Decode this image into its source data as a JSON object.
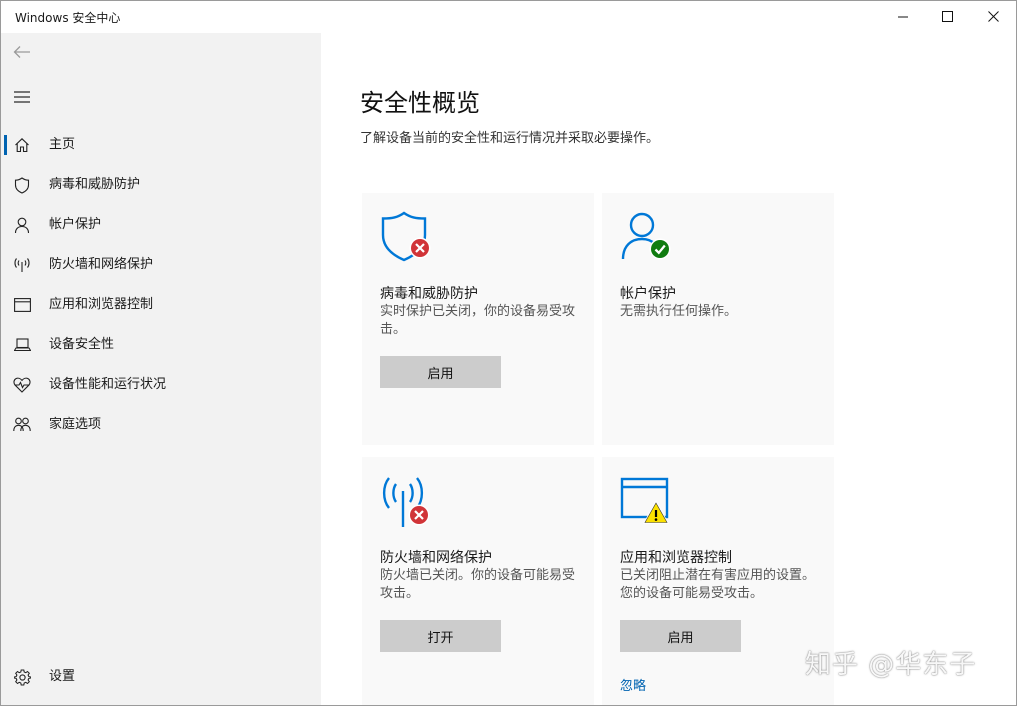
{
  "window": {
    "title": "Windows 安全中心",
    "minimize_icon": "minimize-icon",
    "maximize_icon": "maximize-icon",
    "close_icon": "close-icon"
  },
  "sidebar": {
    "back_icon": "back-arrow-icon",
    "menu_icon": "hamburger-menu-icon",
    "items": [
      {
        "label": "主页",
        "icon": "home-icon",
        "selected": true
      },
      {
        "label": "病毒和威胁防护",
        "icon": "shield-icon"
      },
      {
        "label": "帐户保护",
        "icon": "person-icon"
      },
      {
        "label": "防火墙和网络保护",
        "icon": "antenna-icon"
      },
      {
        "label": "应用和浏览器控制",
        "icon": "browser-window-icon"
      },
      {
        "label": "设备安全性",
        "icon": "laptop-icon"
      },
      {
        "label": "设备性能和运行状况",
        "icon": "heart-pulse-icon"
      },
      {
        "label": "家庭选项",
        "icon": "family-icon"
      }
    ],
    "settings": {
      "label": "设置",
      "icon": "gear-icon"
    }
  },
  "main": {
    "title": "安全性概览",
    "subtitle": "了解设备当前的安全性和运行情况并采取必要操作。",
    "cards": [
      {
        "title": "病毒和威胁防护",
        "description": "实时保护已关闭，你的设备易受攻击。",
        "button": "启用",
        "icon": "shield-icon",
        "status_icon": "error-x-icon",
        "status_color": "#d13438"
      },
      {
        "title": "帐户保护",
        "description": "无需执行任何操作。",
        "icon": "person-icon",
        "status_icon": "check-icon",
        "status_color": "#107c10"
      },
      {
        "title": "防火墙和网络保护",
        "description": "防火墙已关闭。你的设备可能易受攻击。",
        "button": "打开",
        "icon": "antenna-icon",
        "status_icon": "error-x-icon",
        "status_color": "#d13438"
      },
      {
        "title": "应用和浏览器控制",
        "description": "已关闭阻止潜在有害应用的设置。您的设备可能易受攻击。",
        "button": "启用",
        "link": "忽略",
        "icon": "browser-window-icon",
        "status_icon": "warning-icon",
        "status_color": "#fce100"
      }
    ]
  },
  "watermark": "知乎 @华东子",
  "colors": {
    "accent": "#0063b1",
    "icon_blue": "#0078d7",
    "sidebar_bg": "#f2f2f2",
    "card_bg": "#f9f9f9",
    "button_bg": "#cccccc"
  }
}
